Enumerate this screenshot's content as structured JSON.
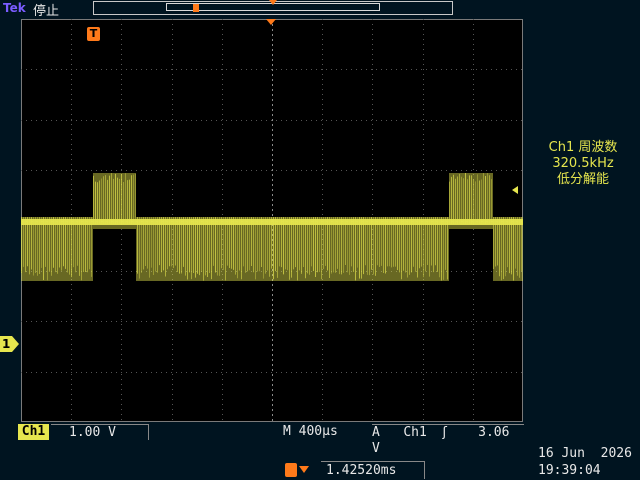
{
  "header": {
    "brand": "Tek",
    "state": "停止"
  },
  "marker": {
    "trigger": "T"
  },
  "measurement": {
    "title": "Ch1 周波数",
    "value": "320.5kHz",
    "note": "低分解能"
  },
  "channel": {
    "marker": "1",
    "label": "Ch1",
    "scale": "1.00 V"
  },
  "timebase": {
    "prefix": "M",
    "value": "400µs"
  },
  "trigger": {
    "prefix": "A",
    "source": "Ch1",
    "slope": "ʃ",
    "level": "3.06 V"
  },
  "horizontal_position": {
    "value": "1.42520ms"
  },
  "datetime": {
    "date": "16 Jun  2026",
    "time": "19:39:04"
  },
  "colors": {
    "channel1": "#e6e64e",
    "trigger": "#ff7a1a",
    "background": "#001420"
  }
}
